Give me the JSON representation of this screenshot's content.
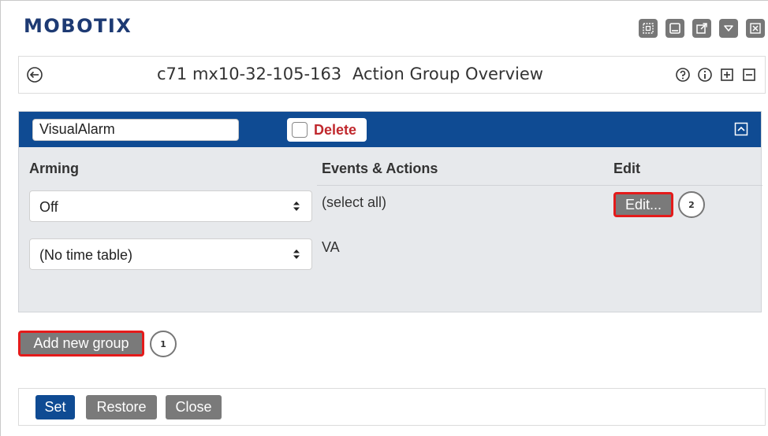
{
  "header": {
    "logo": "MOBOTIX",
    "window_icons": [
      "grid-icon",
      "minimize-icon",
      "external-link-icon",
      "dropdown-icon",
      "close-icon"
    ]
  },
  "title_bar": {
    "camera": "c71 mx10-32-105-163",
    "page_title": "Action Group Overview",
    "tools": [
      "help-icon",
      "info-icon",
      "expand-all-icon",
      "collapse-all-icon"
    ]
  },
  "group": {
    "name": "VisualAlarm",
    "delete_label": "Delete",
    "columns": {
      "arming": "Arming",
      "events_actions": "Events & Actions",
      "edit": "Edit"
    },
    "arming_value": "Off",
    "time_table_value": "(No time table)",
    "events": [
      "(select all)",
      "VA"
    ],
    "edit_label": "Edit..."
  },
  "add_group_label": "Add new group",
  "callouts": [
    "1",
    "2"
  ],
  "footer": {
    "set": "Set",
    "restore": "Restore",
    "close": "Close"
  },
  "colors": {
    "brand": "#0f4b93",
    "logo": "#1d3a73",
    "highlight": "#e41b1b",
    "danger": "#c0282d",
    "button_gray": "#7a7a7a"
  }
}
